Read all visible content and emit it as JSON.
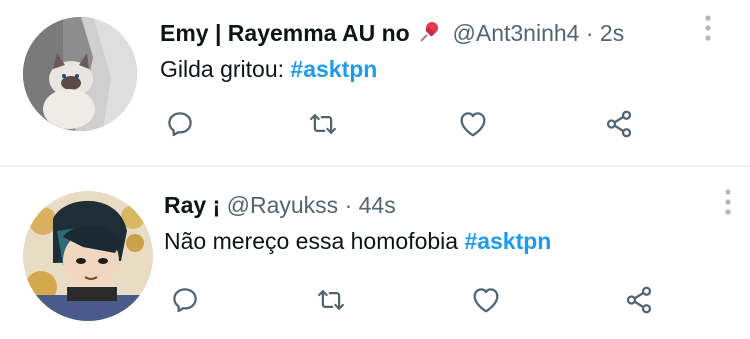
{
  "tweets": [
    {
      "display_name": "Emy | Rayemma AU no",
      "badge_icon": "pushpin-icon",
      "handle": "@Ant3ninh4",
      "separator": "·",
      "time": "2s",
      "text": "Gilda gritou: ",
      "hashtag": "#asktpn",
      "avatar_icon": "cat-avatar-image"
    },
    {
      "display_name": "Ray ¡",
      "handle": "@Rayukss",
      "separator": "·",
      "time": "44s",
      "text": "Não mereço essa homofobia ",
      "hashtag": "#asktpn",
      "avatar_icon": "anime-character-avatar-image"
    }
  ],
  "actions": [
    "reply-icon",
    "retweet-icon",
    "like-icon",
    "share-icon"
  ],
  "colors": {
    "text": "#0f1419",
    "secondary": "#536471",
    "link": "#1d9bf0",
    "divider": "#eff3f4"
  }
}
